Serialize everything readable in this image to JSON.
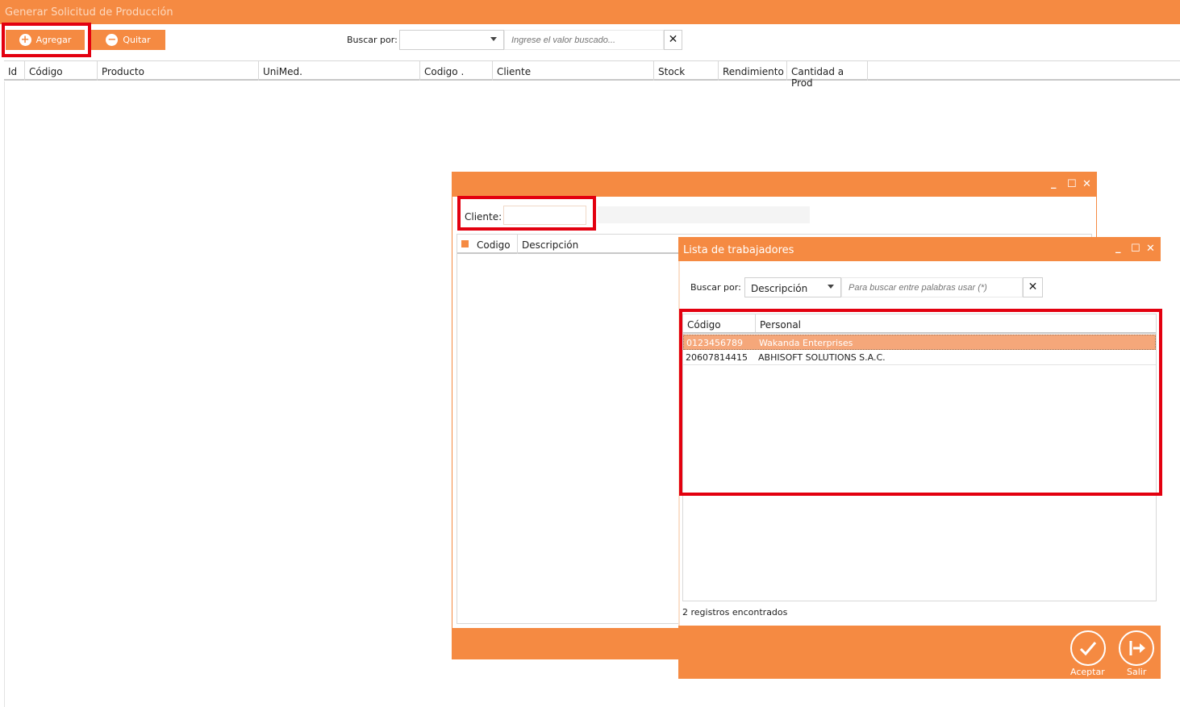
{
  "app": {
    "title": "Generar Solicitud de Producción"
  },
  "toolbar": {
    "add_label": "Agregar",
    "remove_label": "Quitar",
    "search_by_label": "Buscar por:",
    "search_by_value": "",
    "search_placeholder": "Ingrese el valor buscado...",
    "clear_icon": "close-icon"
  },
  "grid": {
    "columns": [
      "Id",
      "Código",
      "Producto",
      "UniMed.",
      "Codigo .",
      "Cliente",
      "Stock",
      "Rendimiento",
      "Cantidad a Prod"
    ],
    "rows": []
  },
  "client_window": {
    "cliente_label": "Cliente:",
    "cliente_value": "",
    "columns": [
      "Codigo",
      "Descripción"
    ]
  },
  "workers_window": {
    "title": "Lista de trabajadores",
    "search_by_label": "Buscar por:",
    "search_by_value": "Descripción",
    "search_placeholder": "Para buscar entre palabras usar (*)",
    "columns": [
      "Código",
      "Personal"
    ],
    "rows": [
      {
        "codigo": "0123456789",
        "personal": "Wakanda Enterprises",
        "selected": true
      },
      {
        "codigo": "20607814415",
        "personal": "ABHISOFT SOLUTIONS S.A.C.",
        "selected": false
      }
    ],
    "status": "2 registros encontrados",
    "accept_label": "Aceptar",
    "exit_label": "Salir"
  },
  "colors": {
    "accent": "#F58A42",
    "highlight": "#E3000F",
    "selected_row": "#F5A77A"
  }
}
